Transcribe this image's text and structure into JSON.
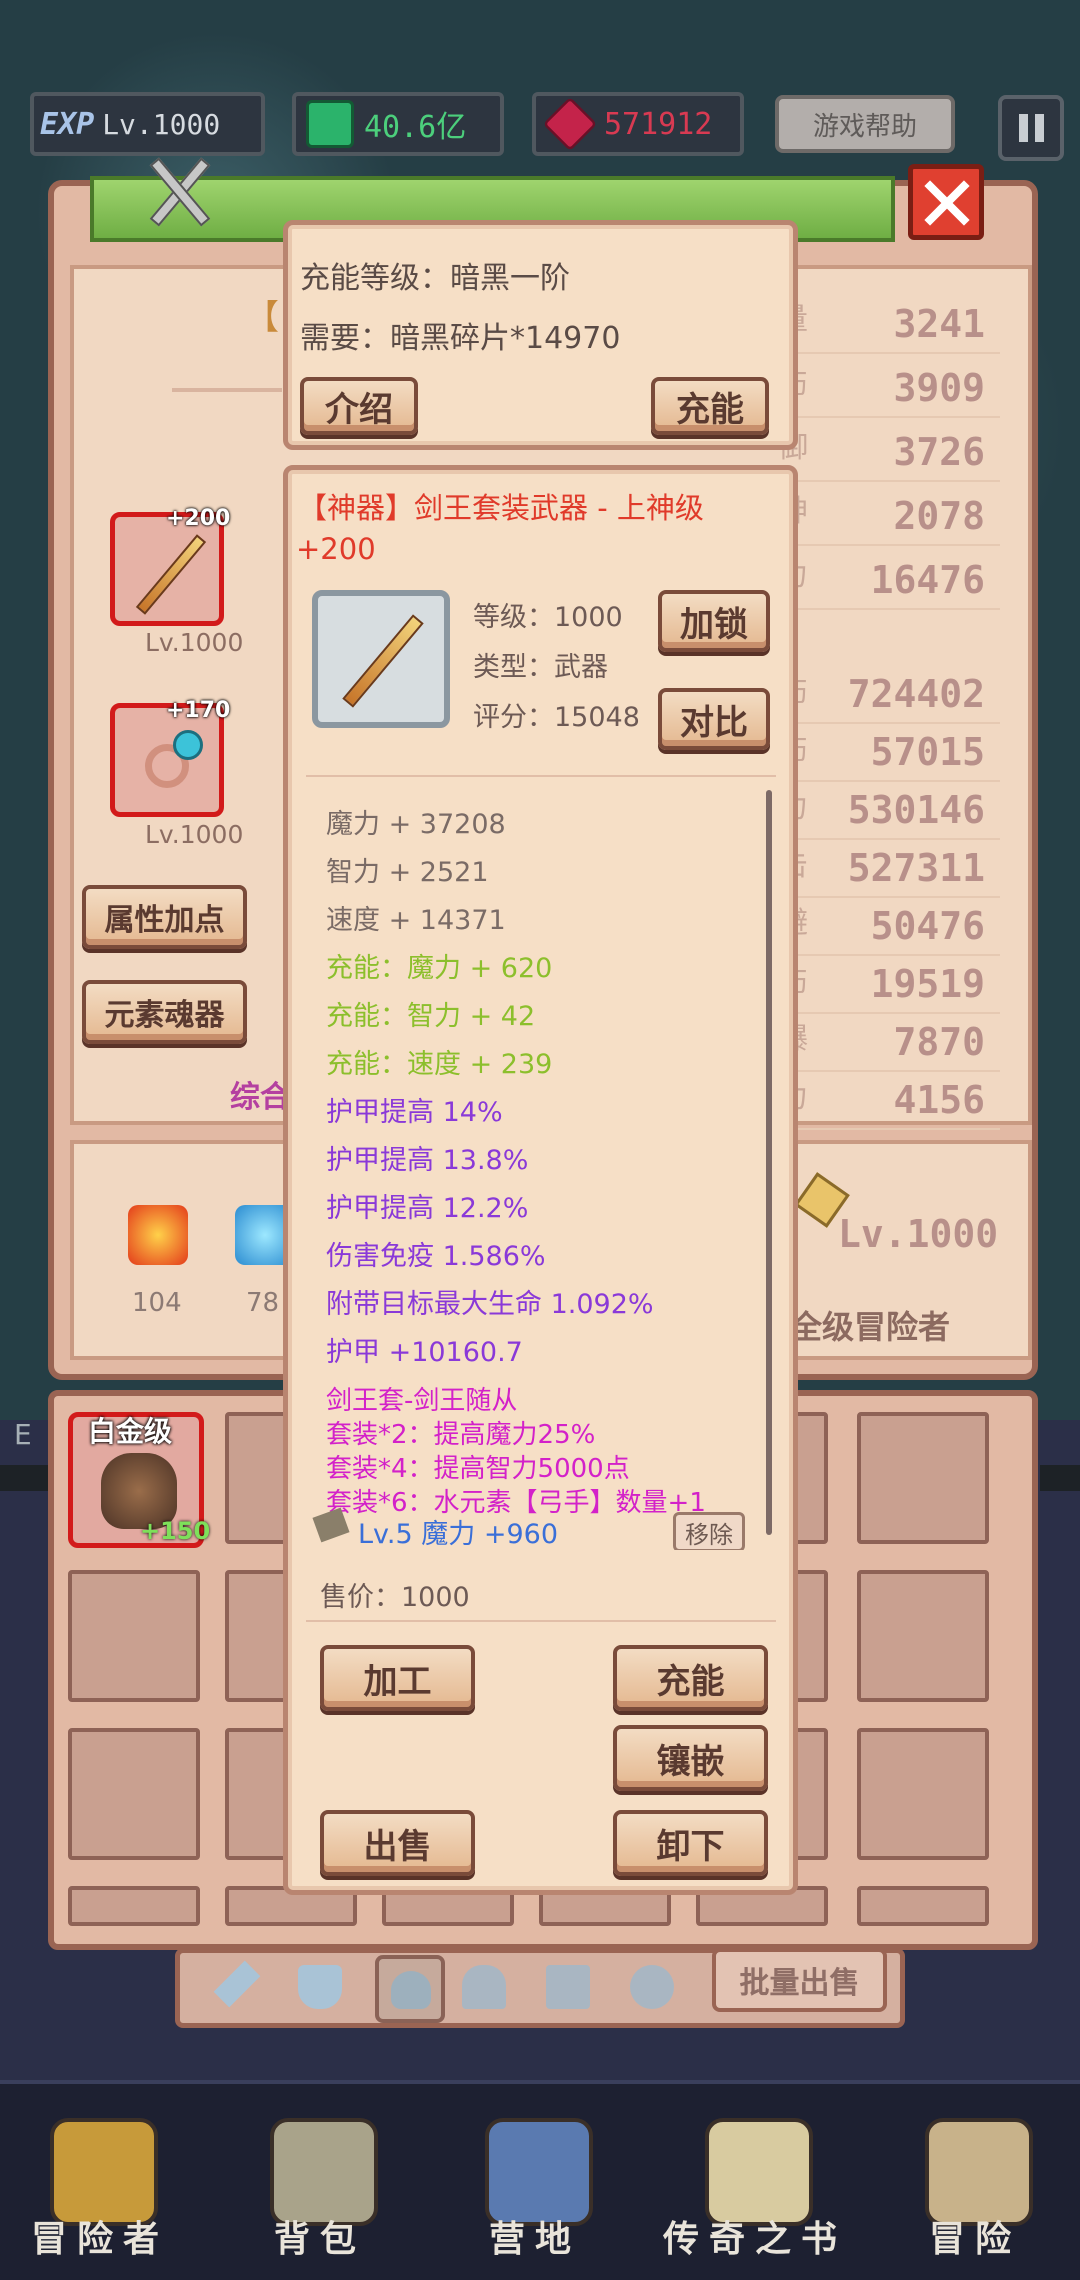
{
  "hud": {
    "exp_badge": "EXP",
    "level": "Lv.1000",
    "gems": "40.6亿",
    "rubies": "571912",
    "help_label": "游戏帮助",
    "pause_icon": "pause-icon"
  },
  "left_panel": {
    "bracket_text": "【",
    "item1_plus": "+200",
    "item1_level": "Lv.1000",
    "item2_plus": "+170",
    "item2_level": "Lv.1000",
    "attr_button": "属性加点",
    "soul_button": "元素魂器",
    "summary_label": "综合",
    "elem_fire": "104",
    "elem_water": "78"
  },
  "right_stats": {
    "top": [
      "3241",
      "3909",
      "3726",
      "2078",
      "16476"
    ],
    "bottom": [
      "724402",
      "57015",
      "530146",
      "527311",
      "50476",
      "19519",
      "7870",
      "4156"
    ],
    "row_suffix_chars": [
      "量",
      "伤",
      "御",
      "神",
      "力",
      "伤",
      "伤",
      "力",
      "击",
      "避",
      "伤",
      "爆",
      "力"
    ],
    "hero_level": "Lv.1000",
    "hero_rank": "全级冒险者"
  },
  "companion": {
    "rank": "白金级",
    "plus": "+150",
    "side_letter": "E"
  },
  "tabs": {
    "batch_sell": "批量出售"
  },
  "charge_popup": {
    "level_line": "充能等级：暗黑一阶",
    "need_line": "需要：暗黑碎片*14970",
    "intro_button": "介绍",
    "charge_button": "充能"
  },
  "item_popup": {
    "title": "【神器】剑王套装武器 - 上神级",
    "plus": "+200",
    "level": "等级：1000",
    "type": "类型：武器",
    "score": "评分：15048",
    "lock_button": "加锁",
    "compare_button": "对比",
    "stats": [
      {
        "text": "魔力 + 37208",
        "color": "#7a6b66"
      },
      {
        "text": "智力 + 2521",
        "color": "#7a6b66"
      },
      {
        "text": "速度 + 14371",
        "color": "#7a6b66"
      },
      {
        "text": "充能：魔力 + 620",
        "color": "#8cbf2c"
      },
      {
        "text": "充能：智力 + 42",
        "color": "#8cbf2c"
      },
      {
        "text": "充能：速度 + 239",
        "color": "#8cbf2c"
      },
      {
        "text": "护甲提高 14%",
        "color": "#8a39d8"
      },
      {
        "text": "护甲提高 13.8%",
        "color": "#8a39d8"
      },
      {
        "text": "护甲提高 12.2%",
        "color": "#8a39d8"
      },
      {
        "text": "伤害免疫 1.586%",
        "color": "#8a39d8"
      },
      {
        "text": "附带目标最大生命 1.092%",
        "color": "#8a39d8"
      },
      {
        "text": "护甲 +10160.7",
        "color": "#8a39d8"
      }
    ],
    "set_lines": [
      "剑王套-剑王随从",
      "套装*2：提高魔力25%",
      "套装*4：提高智力5000点",
      "套装*6：水元素【弓手】数量+1"
    ],
    "gem_line": "Lv.5 魔力 +960",
    "remove_button": "移除",
    "price": "售价：1000",
    "process_button": "加工",
    "charge_button": "充能",
    "inlay_button": "镶嵌",
    "sell_button": "出售",
    "unequip_button": "卸下"
  },
  "bottom_nav": [
    {
      "label": "冒险者",
      "icon": "helmet-icon"
    },
    {
      "label": "背包",
      "icon": "backpack-icon"
    },
    {
      "label": "营地",
      "icon": "banner-icon"
    },
    {
      "label": "传奇之书",
      "icon": "book-icon"
    },
    {
      "label": "冒险",
      "icon": "sword-icon"
    }
  ],
  "colors": {
    "panel": "#f6dfc6",
    "panel_border": "#b98570",
    "title_red": "#e03a2a",
    "set_magenta": "#d321c9",
    "charge_green": "#8cbf2c",
    "affix_purple": "#8a39d8",
    "gem_blue": "#3a6fd8"
  }
}
